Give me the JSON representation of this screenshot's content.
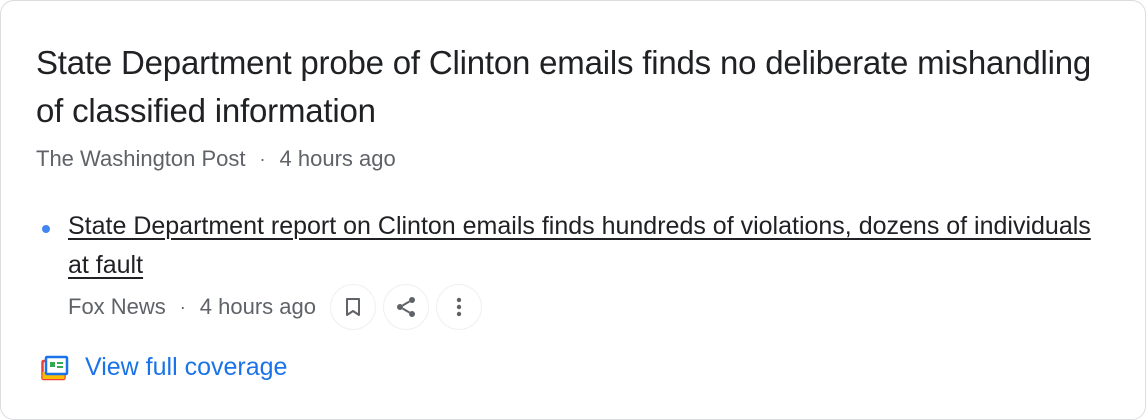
{
  "story": {
    "headline": "State Department probe of Clinton emails finds no deliberate mishandling of classified information",
    "source": "The Washington Post",
    "separator": "·",
    "time": "4 hours ago"
  },
  "related": {
    "title": "State Department report on Clinton emails finds hundreds of violations, dozens of individuals at fault",
    "source": "Fox News",
    "separator": "·",
    "time": "4 hours ago",
    "actions": {
      "save_icon": "bookmark-icon",
      "share_icon": "share-icon",
      "more_icon": "more-vert-icon"
    }
  },
  "coverage": {
    "icon": "full-coverage-icon",
    "label": "View full coverage"
  },
  "colors": {
    "link_blue": "#1a73e8",
    "bullet_blue": "#4285f4",
    "text_primary": "#202124",
    "text_secondary": "#5f6368"
  }
}
